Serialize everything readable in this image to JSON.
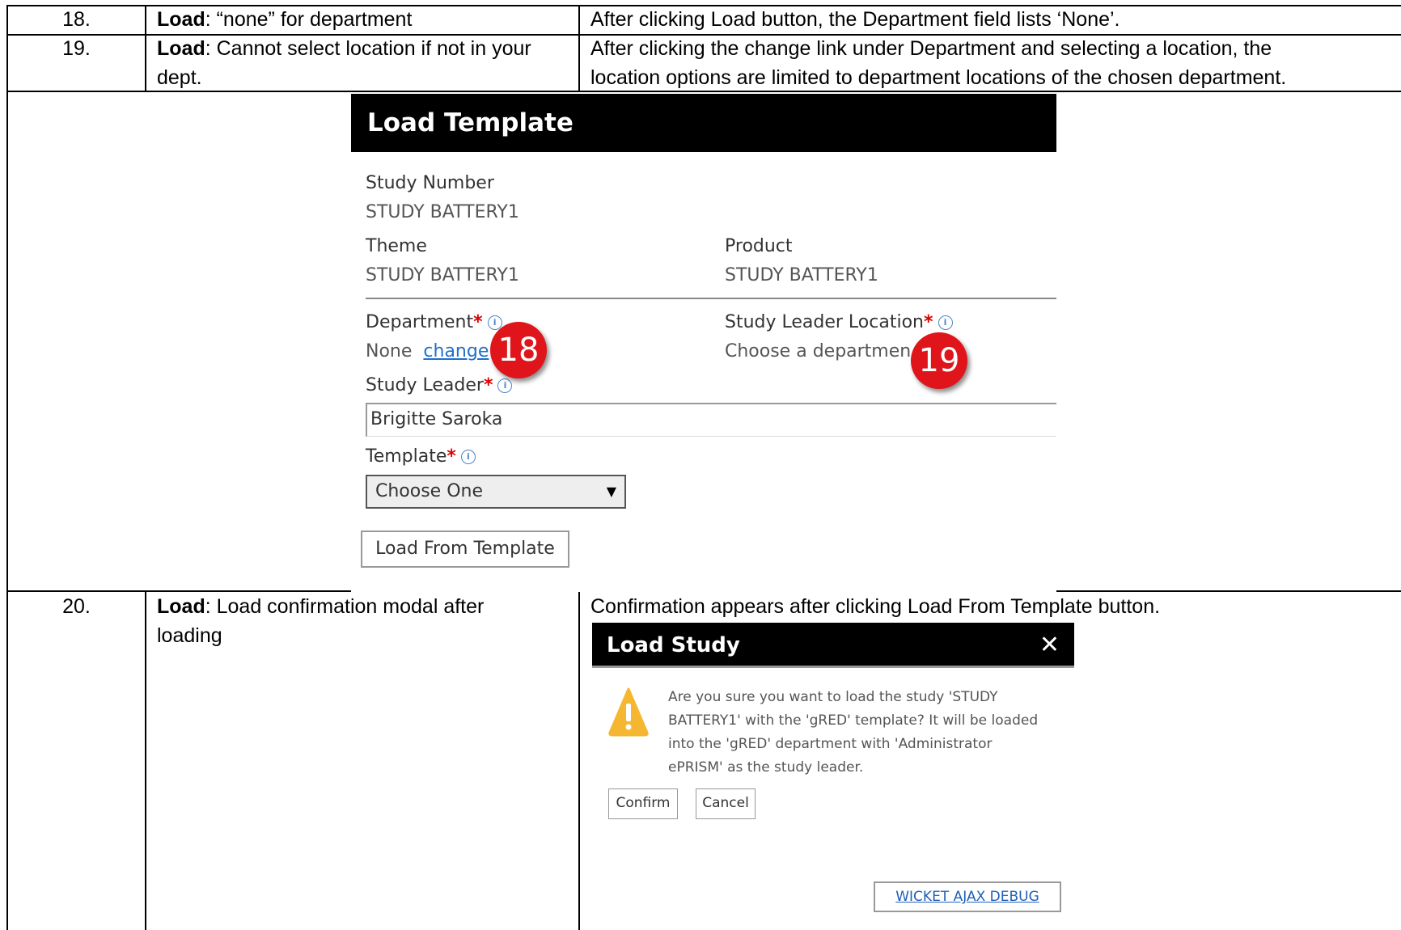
{
  "rows": [
    {
      "num": "18.",
      "title_bold": "Load",
      "title_rest": ": “none” for department",
      "desc": "After clicking Load button, the Department field lists ‘None’."
    },
    {
      "num": "19.",
      "title_bold": "Load",
      "title_rest": ": Cannot select location if not in your",
      "title_rest2": "dept.",
      "desc": "After clicking the change link under Department and selecting a location, the",
      "desc2": "location options are limited to department locations of the chosen department."
    },
    {
      "num": "20.",
      "title_bold": "Load",
      "title_rest": ": Load confirmation modal after",
      "title_rest2": "loading",
      "desc": "Confirmation appears after clicking Load From Template button."
    }
  ],
  "load_template": {
    "title": "Load Template",
    "study_number_label": "Study Number",
    "study_number_value": "STUDY BATTERY1",
    "theme_label": "Theme",
    "theme_value": "STUDY BATTERY1",
    "product_label": "Product",
    "product_value": "STUDY BATTERY1",
    "department_label": "Department",
    "department_value": "None",
    "department_change": "change",
    "location_label": "Study Leader Location",
    "location_value": "Choose a departmen",
    "study_leader_label": "Study Leader",
    "study_leader_value": "Brigitte Saroka",
    "template_label": "Template",
    "template_value": "Choose One",
    "load_button": "Load From Template",
    "required_mark": "*",
    "info_glyph": "i",
    "badge_18": "18",
    "badge_19": "19"
  },
  "load_study": {
    "title": "Load Study",
    "close": "✕",
    "message": "Are you sure you want to load the study 'STUDY BATTERY1' with the 'gRED' template? It will be loaded into the 'gRED' department with 'Administrator ePRISM' as the study leader.",
    "confirm": "Confirm",
    "cancel": "Cancel",
    "debug": "WICKET AJAX DEBUG"
  },
  "colors": {
    "required": "#dd0000",
    "link": "#1f6fc8",
    "badge": "#e0151b",
    "warning": "#f5b731"
  }
}
